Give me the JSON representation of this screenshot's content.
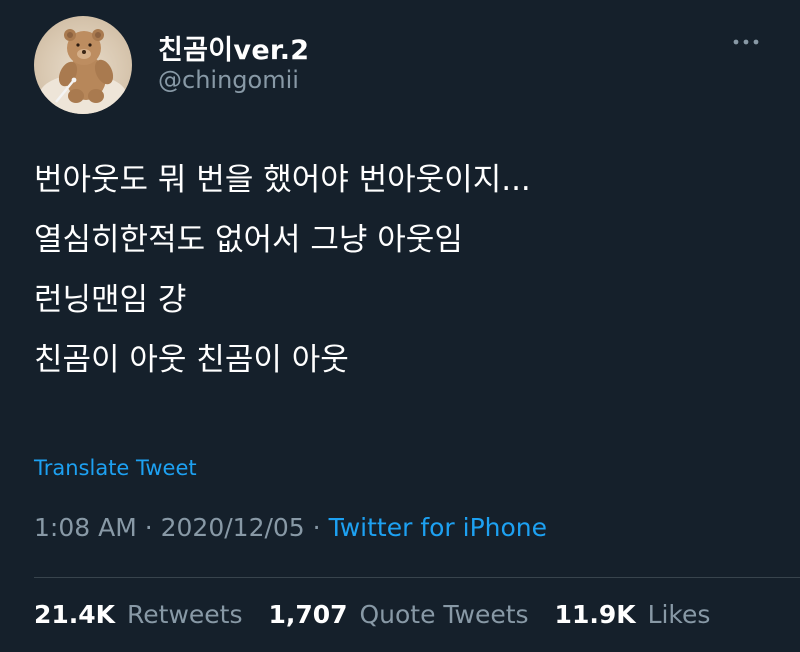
{
  "author": {
    "display_name": "친곰이ver.2",
    "handle": "@chingomii",
    "avatar_icon": "teddy-bear-avatar"
  },
  "menu_icon": "more-dots-icon",
  "tweet": {
    "lines": [
      "번아웃도 뭐 번을 했어야 번아웃이지...",
      "열심히한적도 없어서 그냥 아웃임",
      "런닝맨임 걍",
      "친곰이 아웃 친곰이 아웃"
    ],
    "translate_label": "Translate Tweet",
    "time": "1:08 AM",
    "date": "2020/12/05",
    "separator": "·",
    "source": "Twitter for iPhone"
  },
  "stats": {
    "retweets_count": "21.4K",
    "retweets_label": "Retweets",
    "quotes_count": "1,707",
    "quotes_label": "Quote Tweets",
    "likes_count": "11.9K",
    "likes_label": "Likes"
  },
  "colors": {
    "background": "#15202b",
    "text": "#ffffff",
    "secondary": "#8899a6",
    "accent": "#1da1f2",
    "divider": "#38444d"
  }
}
